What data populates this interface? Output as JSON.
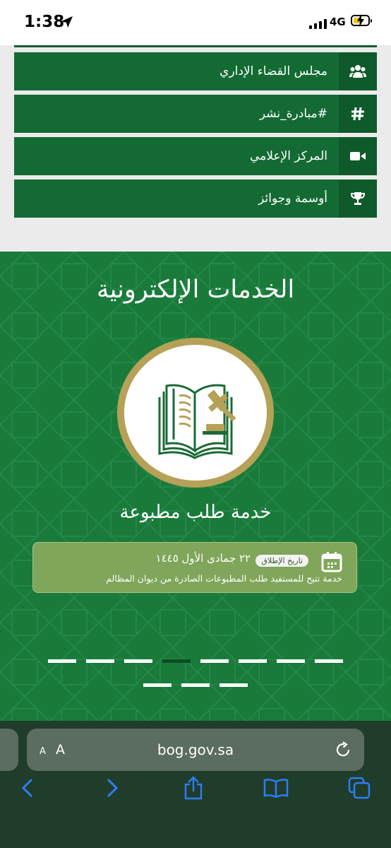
{
  "status_bar": {
    "time": "1:38",
    "network": "4G"
  },
  "menu": {
    "items": [
      {
        "label": "مجلس القضاء الإداري",
        "icon": "users-icon"
      },
      {
        "label": "#مبادرة_نشر",
        "icon": "hashtag-icon"
      },
      {
        "label": "المركز الإعلامي",
        "icon": "video-camera-icon"
      },
      {
        "label": "أوسمة وجوائز",
        "icon": "trophy-icon"
      }
    ]
  },
  "services": {
    "title": "الخدمات الإلكترونية",
    "service_name": "خدمة طلب مطبوعة",
    "card": {
      "badge": "تاريخ الإطلاق",
      "date": "٢٢ جمادى الأول ١٤٤٥",
      "description": "خدمة تتيح للمستفيد طلب المطبوعات الصادرة من ديوان المظالم"
    },
    "pagination": {
      "row1_count": 8,
      "row2_count": 3,
      "active_index": 3
    }
  },
  "browser": {
    "url": "bog.gov.sa",
    "aa_label": "AA"
  },
  "colors": {
    "menu_green": "#136b33",
    "menu_icon_green": "#0f5a2a",
    "services_green": "#1a7a3a",
    "emblem_gold": "#b5a158",
    "card_green": "#7fa65a",
    "browser_bar": "#1f3d2a",
    "toolbar_blue": "#2f7df6"
  }
}
